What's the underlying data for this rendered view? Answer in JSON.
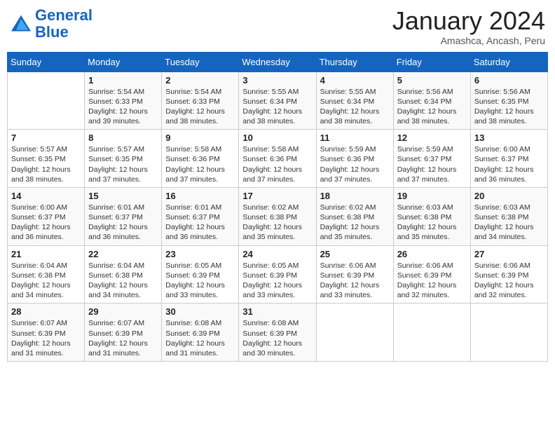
{
  "header": {
    "logo_general": "General",
    "logo_blue": "Blue",
    "month": "January 2024",
    "location": "Amashca, Ancash, Peru"
  },
  "weekdays": [
    "Sunday",
    "Monday",
    "Tuesday",
    "Wednesday",
    "Thursday",
    "Friday",
    "Saturday"
  ],
  "weeks": [
    [
      {
        "day": "",
        "sunrise": "",
        "sunset": "",
        "daylight": ""
      },
      {
        "day": "1",
        "sunrise": "Sunrise: 5:54 AM",
        "sunset": "Sunset: 6:33 PM",
        "daylight": "Daylight: 12 hours and 39 minutes."
      },
      {
        "day": "2",
        "sunrise": "Sunrise: 5:54 AM",
        "sunset": "Sunset: 6:33 PM",
        "daylight": "Daylight: 12 hours and 38 minutes."
      },
      {
        "day": "3",
        "sunrise": "Sunrise: 5:55 AM",
        "sunset": "Sunset: 6:34 PM",
        "daylight": "Daylight: 12 hours and 38 minutes."
      },
      {
        "day": "4",
        "sunrise": "Sunrise: 5:55 AM",
        "sunset": "Sunset: 6:34 PM",
        "daylight": "Daylight: 12 hours and 38 minutes."
      },
      {
        "day": "5",
        "sunrise": "Sunrise: 5:56 AM",
        "sunset": "Sunset: 6:34 PM",
        "daylight": "Daylight: 12 hours and 38 minutes."
      },
      {
        "day": "6",
        "sunrise": "Sunrise: 5:56 AM",
        "sunset": "Sunset: 6:35 PM",
        "daylight": "Daylight: 12 hours and 38 minutes."
      }
    ],
    [
      {
        "day": "7",
        "sunrise": "Sunrise: 5:57 AM",
        "sunset": "Sunset: 6:35 PM",
        "daylight": "Daylight: 12 hours and 38 minutes."
      },
      {
        "day": "8",
        "sunrise": "Sunrise: 5:57 AM",
        "sunset": "Sunset: 6:35 PM",
        "daylight": "Daylight: 12 hours and 37 minutes."
      },
      {
        "day": "9",
        "sunrise": "Sunrise: 5:58 AM",
        "sunset": "Sunset: 6:36 PM",
        "daylight": "Daylight: 12 hours and 37 minutes."
      },
      {
        "day": "10",
        "sunrise": "Sunrise: 5:58 AM",
        "sunset": "Sunset: 6:36 PM",
        "daylight": "Daylight: 12 hours and 37 minutes."
      },
      {
        "day": "11",
        "sunrise": "Sunrise: 5:59 AM",
        "sunset": "Sunset: 6:36 PM",
        "daylight": "Daylight: 12 hours and 37 minutes."
      },
      {
        "day": "12",
        "sunrise": "Sunrise: 5:59 AM",
        "sunset": "Sunset: 6:37 PM",
        "daylight": "Daylight: 12 hours and 37 minutes."
      },
      {
        "day": "13",
        "sunrise": "Sunrise: 6:00 AM",
        "sunset": "Sunset: 6:37 PM",
        "daylight": "Daylight: 12 hours and 36 minutes."
      }
    ],
    [
      {
        "day": "14",
        "sunrise": "Sunrise: 6:00 AM",
        "sunset": "Sunset: 6:37 PM",
        "daylight": "Daylight: 12 hours and 36 minutes."
      },
      {
        "day": "15",
        "sunrise": "Sunrise: 6:01 AM",
        "sunset": "Sunset: 6:37 PM",
        "daylight": "Daylight: 12 hours and 36 minutes."
      },
      {
        "day": "16",
        "sunrise": "Sunrise: 6:01 AM",
        "sunset": "Sunset: 6:37 PM",
        "daylight": "Daylight: 12 hours and 36 minutes."
      },
      {
        "day": "17",
        "sunrise": "Sunrise: 6:02 AM",
        "sunset": "Sunset: 6:38 PM",
        "daylight": "Daylight: 12 hours and 35 minutes."
      },
      {
        "day": "18",
        "sunrise": "Sunrise: 6:02 AM",
        "sunset": "Sunset: 6:38 PM",
        "daylight": "Daylight: 12 hours and 35 minutes."
      },
      {
        "day": "19",
        "sunrise": "Sunrise: 6:03 AM",
        "sunset": "Sunset: 6:38 PM",
        "daylight": "Daylight: 12 hours and 35 minutes."
      },
      {
        "day": "20",
        "sunrise": "Sunrise: 6:03 AM",
        "sunset": "Sunset: 6:38 PM",
        "daylight": "Daylight: 12 hours and 34 minutes."
      }
    ],
    [
      {
        "day": "21",
        "sunrise": "Sunrise: 6:04 AM",
        "sunset": "Sunset: 6:38 PM",
        "daylight": "Daylight: 12 hours and 34 minutes."
      },
      {
        "day": "22",
        "sunrise": "Sunrise: 6:04 AM",
        "sunset": "Sunset: 6:38 PM",
        "daylight": "Daylight: 12 hours and 34 minutes."
      },
      {
        "day": "23",
        "sunrise": "Sunrise: 6:05 AM",
        "sunset": "Sunset: 6:39 PM",
        "daylight": "Daylight: 12 hours and 33 minutes."
      },
      {
        "day": "24",
        "sunrise": "Sunrise: 6:05 AM",
        "sunset": "Sunset: 6:39 PM",
        "daylight": "Daylight: 12 hours and 33 minutes."
      },
      {
        "day": "25",
        "sunrise": "Sunrise: 6:06 AM",
        "sunset": "Sunset: 6:39 PM",
        "daylight": "Daylight: 12 hours and 33 minutes."
      },
      {
        "day": "26",
        "sunrise": "Sunrise: 6:06 AM",
        "sunset": "Sunset: 6:39 PM",
        "daylight": "Daylight: 12 hours and 32 minutes."
      },
      {
        "day": "27",
        "sunrise": "Sunrise: 6:06 AM",
        "sunset": "Sunset: 6:39 PM",
        "daylight": "Daylight: 12 hours and 32 minutes."
      }
    ],
    [
      {
        "day": "28",
        "sunrise": "Sunrise: 6:07 AM",
        "sunset": "Sunset: 6:39 PM",
        "daylight": "Daylight: 12 hours and 31 minutes."
      },
      {
        "day": "29",
        "sunrise": "Sunrise: 6:07 AM",
        "sunset": "Sunset: 6:39 PM",
        "daylight": "Daylight: 12 hours and 31 minutes."
      },
      {
        "day": "30",
        "sunrise": "Sunrise: 6:08 AM",
        "sunset": "Sunset: 6:39 PM",
        "daylight": "Daylight: 12 hours and 31 minutes."
      },
      {
        "day": "31",
        "sunrise": "Sunrise: 6:08 AM",
        "sunset": "Sunset: 6:39 PM",
        "daylight": "Daylight: 12 hours and 30 minutes."
      },
      {
        "day": "",
        "sunrise": "",
        "sunset": "",
        "daylight": ""
      },
      {
        "day": "",
        "sunrise": "",
        "sunset": "",
        "daylight": ""
      },
      {
        "day": "",
        "sunrise": "",
        "sunset": "",
        "daylight": ""
      }
    ]
  ]
}
